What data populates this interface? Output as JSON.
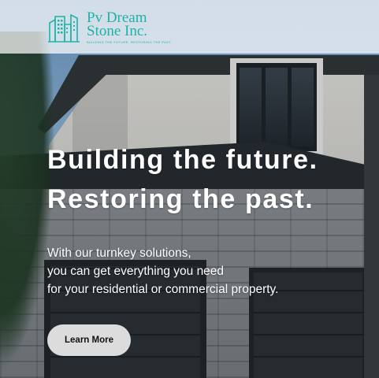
{
  "brand": {
    "name_line1": "Pv Dream",
    "name_line2": "Stone Inc.",
    "tagline": "BUILDING THE FUTURE. RESTORING THE PAST.",
    "color": "#1fb3a8",
    "icon": "buildings-logo-icon"
  },
  "hero": {
    "title_lines": [
      "Building the future.",
      "Restoring the past."
    ],
    "subtitle_lines": [
      "With our turnkey solutions,",
      "you can get everything you need",
      "for your residential or commercial property."
    ],
    "cta_label": "Learn More"
  }
}
